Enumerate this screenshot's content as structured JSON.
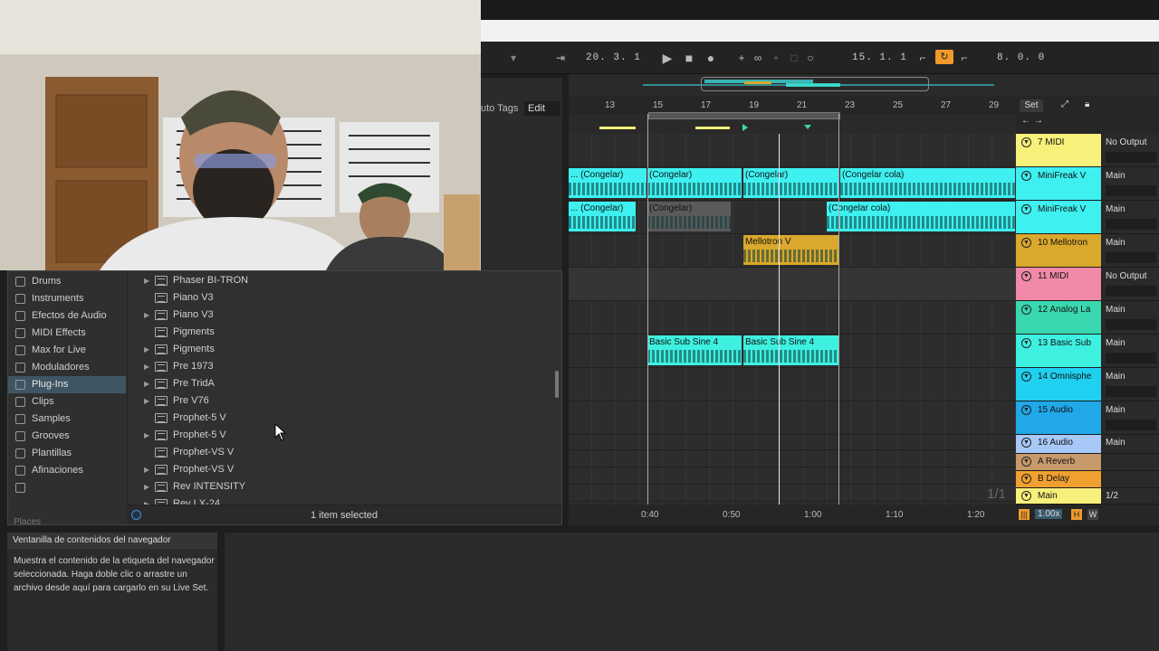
{
  "transport": {
    "arrangement_position": "20.  3.  1",
    "loop_start": "15.  1.  1",
    "loop_length": "8.  0.  0"
  },
  "browser_header": {
    "auto_tags": "uto Tags",
    "edit": "Edit"
  },
  "places": [
    {
      "label": "Drums",
      "icon": "drums-icon"
    },
    {
      "label": "Instruments",
      "icon": "instruments-icon"
    },
    {
      "label": "Efectos de Audio",
      "icon": "audio-effects-icon"
    },
    {
      "label": "MIDI Effects",
      "icon": "midi-effects-icon"
    },
    {
      "label": "Max for Live",
      "icon": "max-for-live-icon"
    },
    {
      "label": "Moduladores",
      "icon": "modulators-icon"
    },
    {
      "label": "Plug-Ins",
      "icon": "plugins-icon",
      "selected": true
    },
    {
      "label": "Clips",
      "icon": "clips-icon"
    },
    {
      "label": "Samples",
      "icon": "samples-icon"
    },
    {
      "label": "Grooves",
      "icon": "grooves-icon"
    },
    {
      "label": "Plantillas",
      "icon": "templates-icon"
    },
    {
      "label": "Afinaciones",
      "icon": "tunings-icon"
    },
    {
      "label": "",
      "icon": "folder-icon"
    }
  ],
  "places_label": "Places",
  "plugins": [
    {
      "label": "Phaser BI-TRON",
      "expandable": true
    },
    {
      "label": "Piano V3",
      "expandable": false
    },
    {
      "label": "Piano V3",
      "expandable": true
    },
    {
      "label": "Pigments",
      "expandable": false
    },
    {
      "label": "Pigments",
      "expandable": true
    },
    {
      "label": "Pre 1973",
      "expandable": true
    },
    {
      "label": "Pre TridA",
      "expandable": true
    },
    {
      "label": "Pre V76",
      "expandable": true
    },
    {
      "label": "Prophet-5 V",
      "expandable": false
    },
    {
      "label": "Prophet-5 V",
      "expandable": true
    },
    {
      "label": "Prophet-VS V",
      "expandable": false
    },
    {
      "label": "Prophet-VS V",
      "expandable": true
    },
    {
      "label": "Rev INTENSITY",
      "expandable": true
    },
    {
      "label": "Rev LX-24",
      "expandable": true
    }
  ],
  "browser_status": "1 item selected",
  "info": {
    "title": "Ventanilla de contenidos del navegador",
    "text": "Muestra el contenido de la etiqueta del navegador seleccionada. Haga doble clic o arrastre un archivo desde aquí para cargarlo en su Live Set."
  },
  "ruler_bars": [
    "13",
    "15",
    "17",
    "19",
    "21",
    "23",
    "25",
    "27",
    "29"
  ],
  "time_ticks": [
    "0:40",
    "0:50",
    "1:00",
    "1:10",
    "1:20"
  ],
  "clips": [
    {
      "lane": 1,
      "label": "... (Congelar)",
      "color": "#3ef0f0"
    },
    {
      "lane": 1,
      "label": "(Congelar)",
      "color": "#3ef0f0"
    },
    {
      "lane": 1,
      "label": "(Congelar)",
      "color": "#3ef0f0"
    },
    {
      "lane": 1,
      "label": "(Congelar cola)",
      "color": "#3ef0f0"
    },
    {
      "lane": 2,
      "label": "... (Congelar)",
      "color": "#3ef0f0"
    },
    {
      "lane": 2,
      "label": "(Congelar)",
      "color": "#5a5a5a"
    },
    {
      "lane": 2,
      "label": "(Congelar cola)",
      "color": "#3ef0f0"
    },
    {
      "lane": 3,
      "label": "Mellotron V",
      "color": "#d9a82c"
    },
    {
      "lane": 6,
      "label": "Basic Sub Sine 4",
      "color": "#3ef0e0"
    },
    {
      "lane": 6,
      "label": "Basic Sub Sine 4",
      "color": "#3ef0e0"
    }
  ],
  "page_indicator": "1/1",
  "mixer": {
    "set_label": "Set",
    "tracks": [
      {
        "name": "7 MIDI",
        "color": "#f7f07a",
        "output": "No Output"
      },
      {
        "name": "MiniFreak V",
        "color": "#3ef0f0",
        "output": "Main"
      },
      {
        "name": "MiniFreak V",
        "color": "#3ef0f0",
        "output": "Main"
      },
      {
        "name": "10 Mellotron",
        "color": "#d9a82c",
        "output": "Main"
      },
      {
        "name": "11 MIDI",
        "color": "#f08aa8",
        "output": "No Output"
      },
      {
        "name": "12 Analog La",
        "color": "#3ad8b0",
        "output": "Main"
      },
      {
        "name": "13 Basic Sub",
        "color": "#3ef0e0",
        "output": "Main"
      },
      {
        "name": "14 Omnisphe",
        "color": "#20d0f0",
        "output": "Main"
      },
      {
        "name": "15 Audio",
        "color": "#20a8e8",
        "output": "Main"
      },
      {
        "name": "16 Audio",
        "color": "#a8c8f8",
        "output": "Main"
      },
      {
        "name": "A Reverb",
        "color": "#c89a6a",
        "output": ""
      },
      {
        "name": "B Delay",
        "color": "#f0a030",
        "output": ""
      },
      {
        "name": "Main",
        "color": "#f7f07a",
        "output": "1/2"
      }
    ],
    "zoom": "1.00x",
    "h_label": "H",
    "w_label": "W"
  }
}
